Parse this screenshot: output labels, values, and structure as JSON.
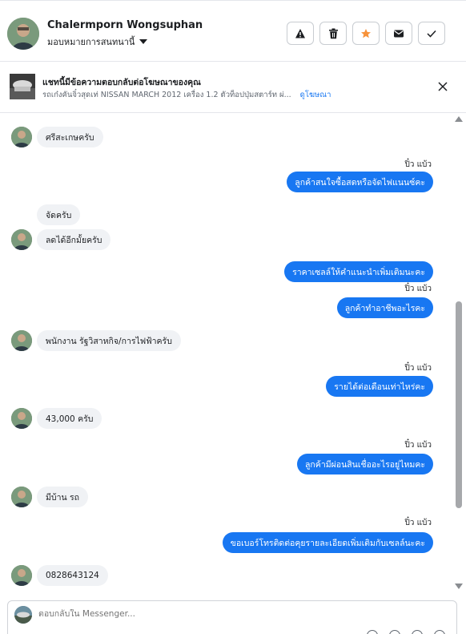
{
  "header": {
    "name": "Chalermporn Wongsuphan",
    "assign_label": "มอบหมายการสนทนานี้",
    "actions": [
      "mark-spam",
      "delete",
      "star",
      "mark-unread",
      "mark-done"
    ]
  },
  "ad": {
    "title": "แชทนี้มีข้อความตอบกลับต่อโฆษณาของคุณ",
    "subtitle": "รถเก๋งคันจิ๋วสุดเท่ NISSAN MARCH 2012 เครื่อง 1.2 ตัวท็อปปุ่มสตาร์ท ผ่...",
    "link": "ดูโฆษณา"
  },
  "messages": [
    {
      "dir": "in",
      "text": "ศรีสะเกษครับ",
      "avatar": true
    },
    {
      "dir": "out",
      "sender": "ปิ๋ว แบ้ว",
      "text": "ลูกค้าสนใจซื้อสดหรือจัดไฟแนนซ์คะ"
    },
    {
      "dir": "in",
      "text": "จัดครับ",
      "avatar": false
    },
    {
      "dir": "in",
      "text": "ลดได้อีกมั้ยครับ",
      "avatar": true
    },
    {
      "dir": "out",
      "sender": "",
      "text": "ราคาเซลล์ให้คำแนะนำเพิ่มเติมนะคะ"
    },
    {
      "dir": "out",
      "sender": "ปิ๋ว แบ้ว",
      "text": "ลูกค้าทำอาชีพอะไรคะ"
    },
    {
      "dir": "in",
      "text": "พนักงาน รัฐวิสาหกิจ/การไฟฟ้าครับ",
      "avatar": true
    },
    {
      "dir": "out",
      "sender": "ปิ๋ว แบ้ว",
      "text": "รายได้ต่อเดือนเท่าไหร่คะ"
    },
    {
      "dir": "in",
      "text": "43,000 ครับ",
      "avatar": true
    },
    {
      "dir": "out",
      "sender": "ปิ๋ว แบ้ว",
      "text": "ลูกค้ามีผ่อนสินเชื่ออะไรอยู่ไหมคะ"
    },
    {
      "dir": "in",
      "text": "มีบ้าน รถ",
      "avatar": true
    },
    {
      "dir": "out",
      "sender": "ปิ๋ว แบ้ว",
      "text": "ขอเบอร์โทรติดต่อคุยรายละเอียดเพิ่มเติมกับเซลล์นะคะ"
    },
    {
      "dir": "in",
      "text": "0828643124",
      "avatar": true
    }
  ],
  "composer": {
    "placeholder": "ตอบกลับใน Messenger..."
  },
  "colors": {
    "accent": "#1877f2",
    "bubble_in": "#f0f2f5",
    "star": "#f7923a"
  }
}
